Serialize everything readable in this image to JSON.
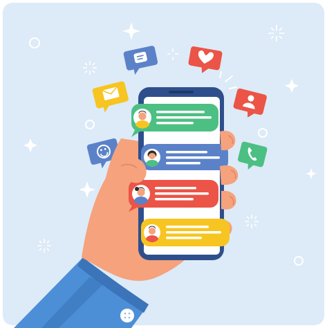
{
  "colors": {
    "background": "#DDEAF7",
    "sparkle": "#FFFFFF",
    "phone_body": "#2E4F8C",
    "phone_screen": "#FFFFFF",
    "skin": "#F5A27D",
    "skin_shadow": "#E38462",
    "sleeve": "#4D8FD6",
    "sleeve_shadow": "#3B74B8",
    "green": "#4CBF83",
    "blue": "#5B82C8",
    "red": "#EB5447",
    "yellow": "#F7C521",
    "avatar_bg": "#FFFFFF"
  },
  "chat_bubbles": [
    {
      "color": "green",
      "avatar": "man-avatar-icon",
      "side": "left"
    },
    {
      "color": "blue",
      "avatar": "woman-avatar-icon",
      "side": "left"
    },
    {
      "color": "red",
      "avatar": "woman-ponytail-avatar-icon",
      "side": "left"
    },
    {
      "color": "yellow",
      "avatar": "man-red-shirt-avatar-icon",
      "side": "left"
    }
  ],
  "floating_icons": [
    {
      "name": "chat-icon",
      "color": "blue"
    },
    {
      "name": "heart-icon",
      "color": "red"
    },
    {
      "name": "mail-icon",
      "color": "yellow"
    },
    {
      "name": "user-icon",
      "color": "red"
    },
    {
      "name": "smile-icon",
      "color": "blue"
    },
    {
      "name": "phone-icon",
      "color": "green"
    }
  ]
}
